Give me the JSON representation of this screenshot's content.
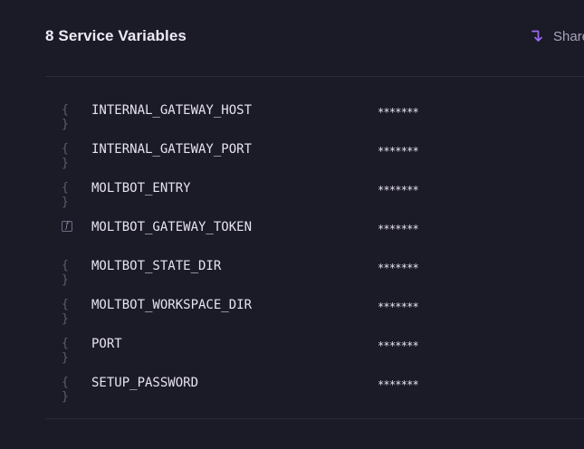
{
  "header": {
    "title": "8 Service Variables",
    "shared_label": "Share",
    "accent_color": "#9b6cf2"
  },
  "variables": [
    {
      "name": "INTERNAL_GATEWAY_HOST",
      "value": "*******",
      "icon": "braces-icon",
      "icon_glyph": "{ }"
    },
    {
      "name": "INTERNAL_GATEWAY_PORT",
      "value": "*******",
      "icon": "braces-icon",
      "icon_glyph": "{ }"
    },
    {
      "name": "MOLTBOT_ENTRY",
      "value": "*******",
      "icon": "braces-icon",
      "icon_glyph": "{ }"
    },
    {
      "name": "MOLTBOT_GATEWAY_TOKEN",
      "value": "*******",
      "icon": "function-icon",
      "icon_glyph": "f"
    },
    {
      "name": "MOLTBOT_STATE_DIR",
      "value": "*******",
      "icon": "braces-icon",
      "icon_glyph": "{ }"
    },
    {
      "name": "MOLTBOT_WORKSPACE_DIR",
      "value": "*******",
      "icon": "braces-icon",
      "icon_glyph": "{ }"
    },
    {
      "name": "PORT",
      "value": "*******",
      "icon": "braces-icon",
      "icon_glyph": "{ }"
    },
    {
      "name": "SETUP_PASSWORD",
      "value": "*******",
      "icon": "braces-icon",
      "icon_glyph": "{ }"
    }
  ]
}
